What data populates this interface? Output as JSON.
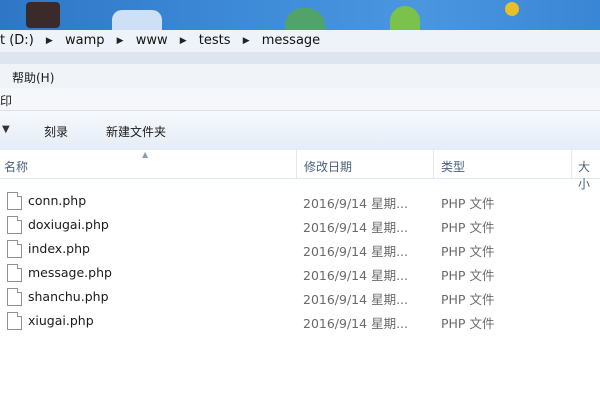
{
  "address": {
    "segments": [
      "t (D:)",
      "wamp",
      "www",
      "tests",
      "message"
    ]
  },
  "menu": {
    "help_label": "帮助(H)"
  },
  "strip": {
    "label": "印"
  },
  "toolbar": {
    "burn_label": "刻录",
    "new_folder_label": "新建文件夹"
  },
  "columns": {
    "name": "名称",
    "date": "修改日期",
    "type": "类型",
    "size": "大小"
  },
  "files": [
    {
      "name": "conn.php",
      "date": "2016/9/14 星期...",
      "type": "PHP 文件",
      "icon": "file-icon"
    },
    {
      "name": "doxiugai.php",
      "date": "2016/9/14 星期...",
      "type": "PHP 文件",
      "icon": "file-icon"
    },
    {
      "name": "index.php",
      "date": "2016/9/14 星期...",
      "type": "PHP 文件",
      "icon": "file-icon"
    },
    {
      "name": "message.php",
      "date": "2016/9/14 星期...",
      "type": "PHP 文件",
      "icon": "file-icon"
    },
    {
      "name": "shanchu.php",
      "date": "2016/9/14 星期...",
      "type": "PHP 文件",
      "icon": "file-icon"
    },
    {
      "name": "xiugai.php",
      "date": "2016/9/14 星期...",
      "type": "PHP 文件",
      "icon": "file-icon"
    }
  ]
}
